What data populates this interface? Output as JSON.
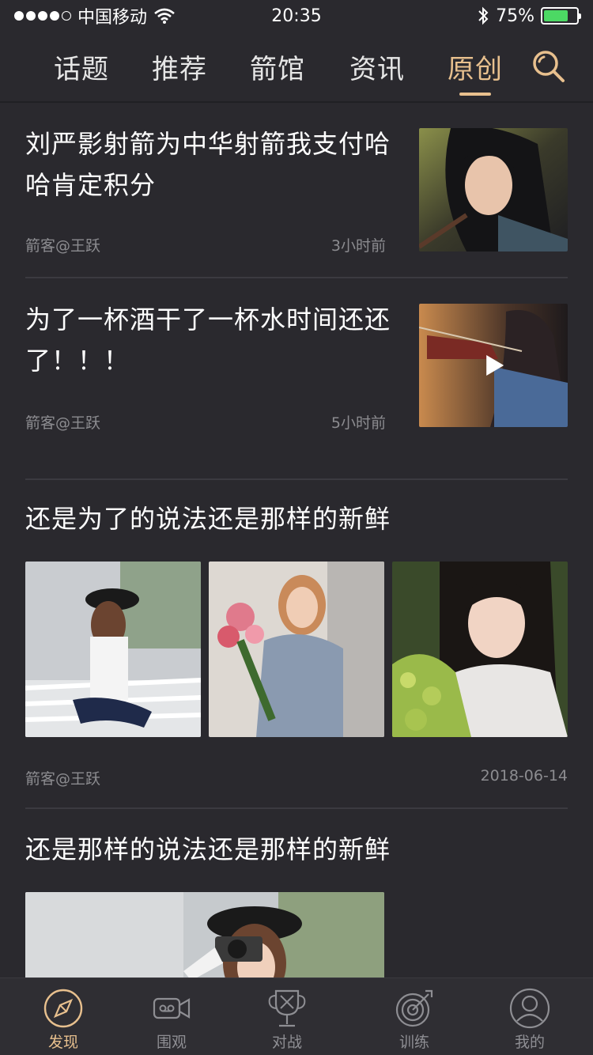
{
  "status_bar": {
    "carrier": "中国移动",
    "time": "20:35",
    "battery": "75%",
    "battery_level": 0.75,
    "battery_color": "#4cd964"
  },
  "top_tabs": [
    {
      "label": "话题",
      "active": false
    },
    {
      "label": "推荐",
      "active": false
    },
    {
      "label": "箭馆",
      "active": false
    },
    {
      "label": "资讯",
      "active": false
    },
    {
      "label": "原创",
      "active": true
    }
  ],
  "search_icon": "search-icon",
  "accent_color": "#e8c08e",
  "feed": [
    {
      "title": "刘严影射箭为中华射箭我支付哈哈肯定积分",
      "author": "箭客@王跃",
      "time": "3小时前",
      "media": "single-image"
    },
    {
      "title": "为了一杯酒干了一杯水时间还还了！！！",
      "author": "箭客@王跃",
      "time": "5小时前",
      "media": "video"
    },
    {
      "title": "还是为了的说法还是那样的新鲜",
      "author": "箭客@王跃",
      "time": "2018-06-14",
      "media": "three-images"
    },
    {
      "title": "还是那样的说法还是那样的新鲜",
      "media": "large-image"
    }
  ],
  "bottom_nav": [
    {
      "label": "发现",
      "icon": "compass-icon",
      "active": true
    },
    {
      "label": "围观",
      "icon": "video-camera-icon",
      "active": false
    },
    {
      "label": "对战",
      "icon": "trophy-arrows-icon",
      "active": false
    },
    {
      "label": "训练",
      "icon": "target-icon",
      "active": false
    },
    {
      "label": "我的",
      "icon": "user-icon",
      "active": false
    }
  ]
}
